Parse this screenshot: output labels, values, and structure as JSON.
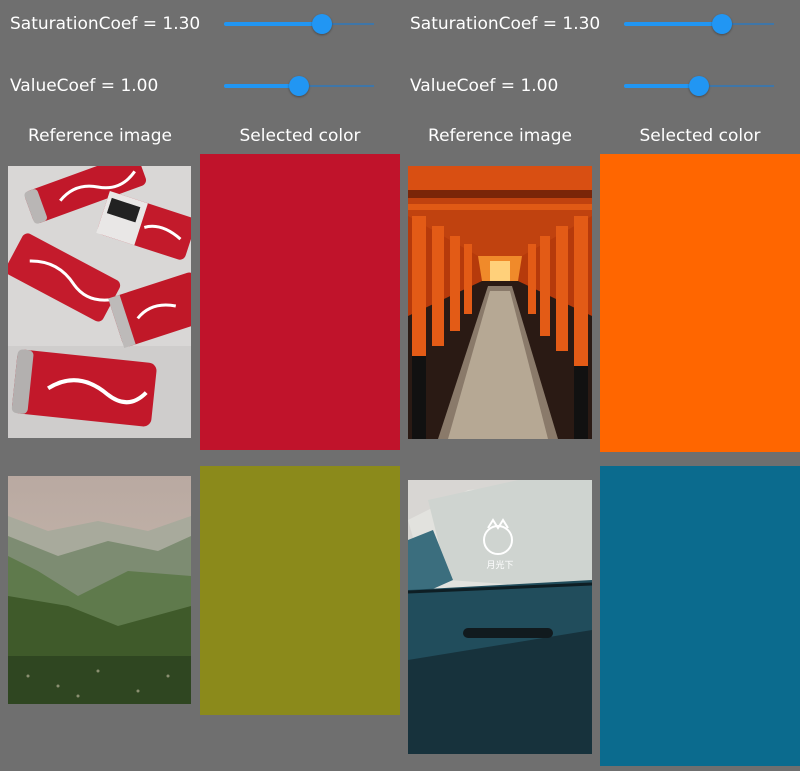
{
  "controls": [
    {
      "sat_label": "SaturationCoef = 1.30",
      "sat_level": 0.65,
      "val_label": "ValueCoef = 1.00",
      "val_level": 0.5
    },
    {
      "sat_label": "SaturationCoef = 1.30",
      "sat_level": 0.65,
      "val_label": "ValueCoef = 1.00",
      "val_level": 0.5
    }
  ],
  "headers": {
    "reference": "Reference image",
    "selected": "Selected color"
  },
  "cells": [
    {
      "photo": "coca-cola cans on white surface",
      "color": "#c0132b"
    },
    {
      "photo": "orange torii gate tunnel",
      "color": "#ff6600"
    },
    {
      "photo": "misty green mountain valley",
      "color": "#8b8a1b"
    },
    {
      "photo": "blue car side door with samurai sticker",
      "color": "#0b6b8e"
    }
  ],
  "sticker_text": "月光下"
}
